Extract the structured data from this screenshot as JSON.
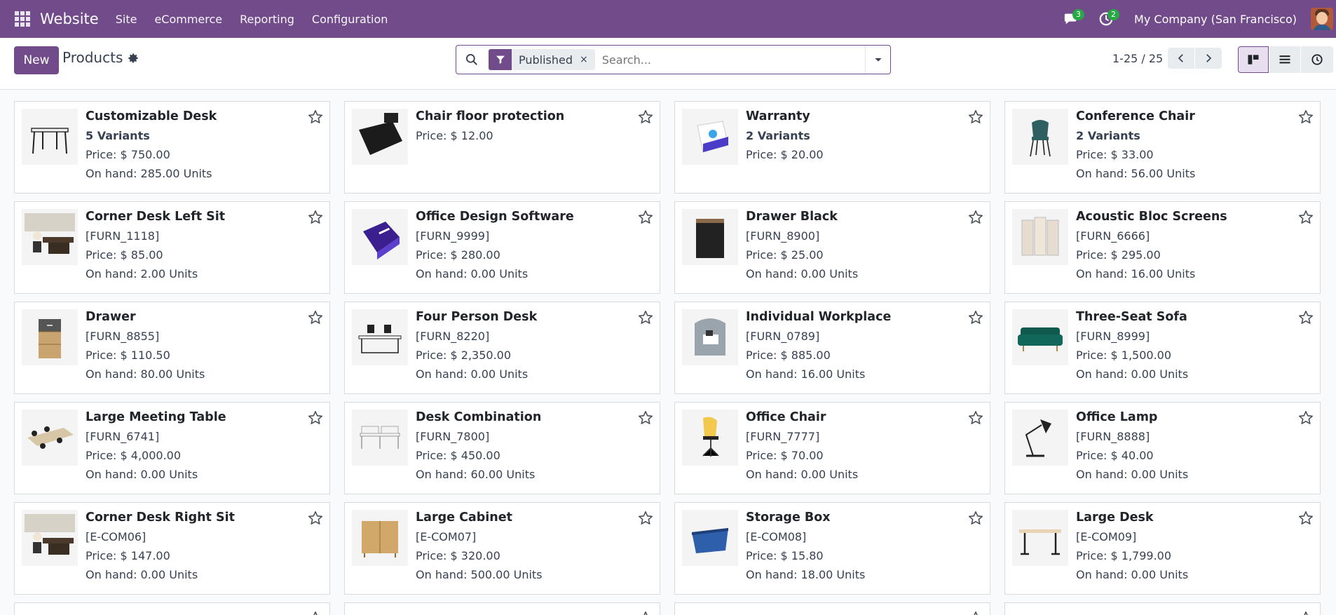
{
  "navbar": {
    "app_name": "Website",
    "menu": [
      "Site",
      "eCommerce",
      "Reporting",
      "Configuration"
    ],
    "messages_count": "3",
    "activities_count": "2",
    "company": "My Company (San Francisco)"
  },
  "control": {
    "new_label": "New",
    "breadcrumb": "Products",
    "facet": "Published",
    "facet_remove": "×",
    "search_placeholder": "Search...",
    "pager": "1-25 / 25"
  },
  "colors": {
    "brand": "#714b8a",
    "counter": "#28a745"
  },
  "products": [
    {
      "name": "Customizable Desk",
      "variants": "5 Variants",
      "price": "Price: $ 750.00",
      "onhand": "On hand: 285.00 Units",
      "img": "desk"
    },
    {
      "name": "Chair floor protection",
      "price": "Price: $ 12.00",
      "img": "mat"
    },
    {
      "name": "Warranty",
      "variants": "2 Variants",
      "price": "Price: $ 20.00",
      "img": "box-blue"
    },
    {
      "name": "Conference Chair",
      "variants": "2 Variants",
      "price": "Price: $ 33.00",
      "onhand": "On hand: 56.00 Units",
      "img": "chair-teal"
    },
    {
      "name": "Corner Desk Left Sit",
      "ref": "[FURN_1118]",
      "price": "Price: $ 85.00",
      "onhand": "On hand: 2.00 Units",
      "img": "office-desk"
    },
    {
      "name": "Office Design Software",
      "ref": "[FURN_9999]",
      "price": "Price: $ 280.00",
      "onhand": "On hand: 0.00 Units",
      "img": "software"
    },
    {
      "name": "Drawer Black",
      "ref": "[FURN_8900]",
      "price": "Price: $ 25.00",
      "onhand": "On hand: 0.00 Units",
      "img": "drawer-black"
    },
    {
      "name": "Acoustic Bloc Screens",
      "ref": "[FURN_6666]",
      "price": "Price: $ 295.00",
      "onhand": "On hand: 16.00 Units",
      "img": "screens"
    },
    {
      "name": "Drawer",
      "ref": "[FURN_8855]",
      "price": "Price: $ 110.50",
      "onhand": "On hand: 80.00 Units",
      "img": "drawer-wood"
    },
    {
      "name": "Four Person Desk",
      "ref": "[FURN_8220]",
      "price": "Price: $ 2,350.00",
      "onhand": "On hand: 0.00 Units",
      "img": "four-desk"
    },
    {
      "name": "Individual Workplace",
      "ref": "[FURN_0789]",
      "price": "Price: $ 885.00",
      "onhand": "On hand: 16.00 Units",
      "img": "workplace"
    },
    {
      "name": "Three-Seat Sofa",
      "ref": "[FURN_8999]",
      "price": "Price: $ 1,500.00",
      "onhand": "On hand: 0.00 Units",
      "img": "sofa"
    },
    {
      "name": "Large Meeting Table",
      "ref": "[FURN_6741]",
      "price": "Price: $ 4,000.00",
      "onhand": "On hand: 0.00 Units",
      "img": "meeting"
    },
    {
      "name": "Desk Combination",
      "ref": "[FURN_7800]",
      "price": "Price: $ 450.00",
      "onhand": "On hand: 60.00 Units",
      "img": "combo"
    },
    {
      "name": "Office Chair",
      "ref": "[FURN_7777]",
      "price": "Price: $ 70.00",
      "onhand": "On hand: 0.00 Units",
      "img": "chair-yellow"
    },
    {
      "name": "Office Lamp",
      "ref": "[FURN_8888]",
      "price": "Price: $ 40.00",
      "onhand": "On hand: 0.00 Units",
      "img": "lamp"
    },
    {
      "name": "Corner Desk Right Sit",
      "ref": "[E-COM06]",
      "price": "Price: $ 147.00",
      "onhand": "On hand: 0.00 Units",
      "img": "office-desk"
    },
    {
      "name": "Large Cabinet",
      "ref": "[E-COM07]",
      "price": "Price: $ 320.00",
      "onhand": "On hand: 500.00 Units",
      "img": "cabinet"
    },
    {
      "name": "Storage Box",
      "ref": "[E-COM08]",
      "price": "Price: $ 15.80",
      "onhand": "On hand: 18.00 Units",
      "img": "storage"
    },
    {
      "name": "Large Desk",
      "ref": "[E-COM09]",
      "price": "Price: $ 1,799.00",
      "onhand": "On hand: 0.00 Units",
      "img": "large-desk"
    }
  ]
}
